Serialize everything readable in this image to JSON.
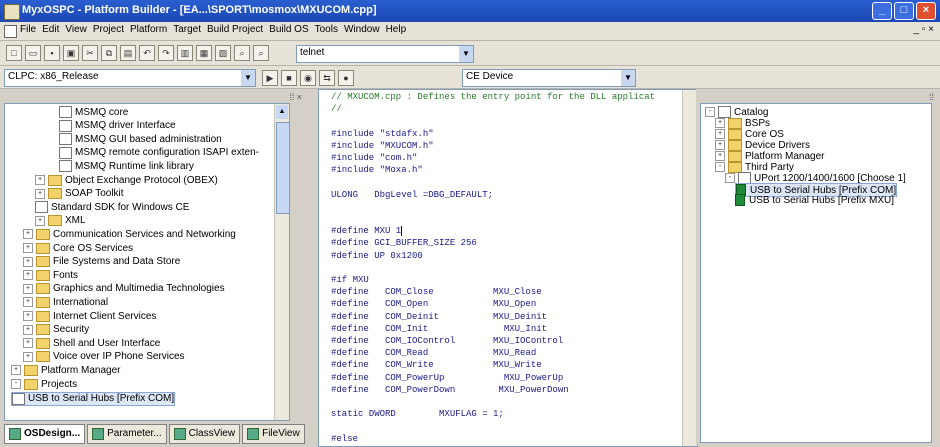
{
  "window": {
    "title": "MyxOSPC - Platform Builder - [EA...\\SPORT\\mosmox\\MXUCOM.cpp]",
    "controls": [
      "_",
      "□",
      "×"
    ]
  },
  "menubar": {
    "items": [
      "File",
      "Edit",
      "View",
      "Project",
      "Platform",
      "Target",
      "Build Project",
      "Build OS",
      "Tools",
      "Window",
      "Help"
    ],
    "mdi_controls": "_ ▫ ×"
  },
  "toolbar1": {
    "find_combo": "telnet",
    "icons": [
      "new-icon",
      "open-icon",
      "save-icon",
      "save-all-icon",
      "cut-icon",
      "copy-icon",
      "paste-icon",
      "undo-icon",
      "redo-icon",
      "workspace-icon",
      "output-icon",
      "windows-icon",
      "find-icon",
      "find-in-files-icon"
    ]
  },
  "toolbar2": {
    "config_combo": "CLPC: x86_Release",
    "device_combo": "CE Device",
    "icons": [
      "build-icon",
      "stop-icon",
      "debug-icon",
      "connect-icon",
      "breakpoint-icon"
    ]
  },
  "left_tree": {
    "items": [
      {
        "label": "MSMQ core",
        "indent": 5,
        "kind": "component"
      },
      {
        "label": "MSMQ driver Interface",
        "indent": 5,
        "kind": "component"
      },
      {
        "label": "MSMQ GUI based administration",
        "indent": 5,
        "kind": "component"
      },
      {
        "label": "MSMQ remote configuration ISAPI exten-",
        "indent": 5,
        "kind": "component"
      },
      {
        "label": "MSMQ Runtime link library",
        "indent": 5,
        "kind": "component"
      },
      {
        "label": "Object Exchange Protocol (OBEX)",
        "indent": 3,
        "kind": "folder",
        "expander": "+"
      },
      {
        "label": "SOAP Toolkit",
        "indent": 3,
        "kind": "folder",
        "expander": "+"
      },
      {
        "label": "Standard SDK for Windows CE",
        "indent": 3,
        "kind": "component"
      },
      {
        "label": "XML",
        "indent": 3,
        "kind": "folder",
        "expander": "+"
      },
      {
        "label": "Communication Services and Networking",
        "indent": 2,
        "kind": "folder",
        "expander": "+"
      },
      {
        "label": "Core OS Services",
        "indent": 2,
        "kind": "folder",
        "expander": "+"
      },
      {
        "label": "File Systems and Data Store",
        "indent": 2,
        "kind": "folder",
        "expander": "+"
      },
      {
        "label": "Fonts",
        "indent": 2,
        "kind": "folder",
        "expander": "+"
      },
      {
        "label": "Graphics and Multimedia Technologies",
        "indent": 2,
        "kind": "folder",
        "expander": "+"
      },
      {
        "label": "International",
        "indent": 2,
        "kind": "folder",
        "expander": "+"
      },
      {
        "label": "Internet Client Services",
        "indent": 2,
        "kind": "folder",
        "expander": "+"
      },
      {
        "label": "Security",
        "indent": 2,
        "kind": "folder",
        "expander": "+"
      },
      {
        "label": "Shell and User Interface",
        "indent": 2,
        "kind": "folder",
        "expander": "+"
      },
      {
        "label": "Voice over IP Phone Services",
        "indent": 2,
        "kind": "folder",
        "expander": "+"
      },
      {
        "label": "Platform Manager",
        "indent": 1,
        "kind": "folder",
        "expander": "+"
      },
      {
        "label": "Projects",
        "indent": 1,
        "kind": "folder",
        "expander": "-"
      },
      {
        "label": "USB to Serial Hubs [Prefix COM]",
        "indent": 1,
        "kind": "component",
        "selected": true
      }
    ]
  },
  "left_tabs": [
    "OSDesign...",
    "Parameter...",
    "ClassView",
    "FileView"
  ],
  "editor": {
    "lines": [
      {
        "text": "// MXUCOM.cpp : Defines the entry point for the DLL applicat",
        "type": "comment"
      },
      {
        "text": "//",
        "type": "comment"
      },
      {
        "text": "",
        "type": "code"
      },
      {
        "text": "#include \"stdafx.h\"",
        "type": "code"
      },
      {
        "text": "#include \"MXUCOM.h\"",
        "type": "code"
      },
      {
        "text": "#include \"com.h\"",
        "type": "code"
      },
      {
        "text": "#include \"Moxa.h\"",
        "type": "code"
      },
      {
        "text": "",
        "type": "code"
      },
      {
        "text": "ULONG   DbgLevel =DBG_DEFAULT;",
        "type": "code"
      },
      {
        "text": "",
        "type": "code"
      },
      {
        "text": "",
        "type": "code"
      },
      {
        "text": "#define MXU 1",
        "type": "code",
        "cursor": true
      },
      {
        "text": "#define GCI_BUFFER_SIZE 256",
        "type": "code"
      },
      {
        "text": "#define UP 0x1200",
        "type": "code"
      },
      {
        "text": "",
        "type": "code"
      },
      {
        "text": "#if MXU",
        "type": "code"
      },
      {
        "text": "#define   COM_Close           MXU_Close",
        "type": "code"
      },
      {
        "text": "#define   COM_Open            MXU_Open",
        "type": "code"
      },
      {
        "text": "#define   COM_Deinit          MXU_Deinit",
        "type": "code"
      },
      {
        "text": "#define   COM_Init              MXU_Init",
        "type": "code"
      },
      {
        "text": "#define   COM_IOControl       MXU_IOControl",
        "type": "code"
      },
      {
        "text": "#define   COM_Read            MXU_Read",
        "type": "code"
      },
      {
        "text": "#define   COM_Write           MXU_Write",
        "type": "code"
      },
      {
        "text": "#define   COM_PowerUp           MXU_PowerUp",
        "type": "code"
      },
      {
        "text": "#define   COM_PowerDown        MXU_PowerDown",
        "type": "code"
      },
      {
        "text": "",
        "type": "code"
      },
      {
        "text": "static DWORD        MXUFLAG = 1;",
        "type": "code"
      },
      {
        "text": "",
        "type": "code"
      },
      {
        "text": "#else",
        "type": "code"
      }
    ]
  },
  "catalog": {
    "items": [
      {
        "label": "Catalog",
        "indent": 0,
        "kind": "root",
        "expander": "-"
      },
      {
        "label": "BSPs",
        "indent": 1,
        "kind": "folder",
        "expander": "+"
      },
      {
        "label": "Core OS",
        "indent": 1,
        "kind": "folder",
        "expander": "+"
      },
      {
        "label": "Device Drivers",
        "indent": 1,
        "kind": "folder",
        "expander": "+"
      },
      {
        "label": "Platform Manager",
        "indent": 1,
        "kind": "folder",
        "expander": "+"
      },
      {
        "label": "Third Party",
        "indent": 1,
        "kind": "folder",
        "expander": "-"
      },
      {
        "label": "UPort 1200/1400/1600 [Choose 1]",
        "indent": 2,
        "kind": "component",
        "expander": "-"
      },
      {
        "label": "USB to Serial Hubs [Prefix COM]",
        "indent": 3,
        "kind": "green",
        "selected": true
      },
      {
        "label": "USB to Serial Hubs [Prefix MXU]",
        "indent": 3,
        "kind": "green"
      }
    ]
  }
}
